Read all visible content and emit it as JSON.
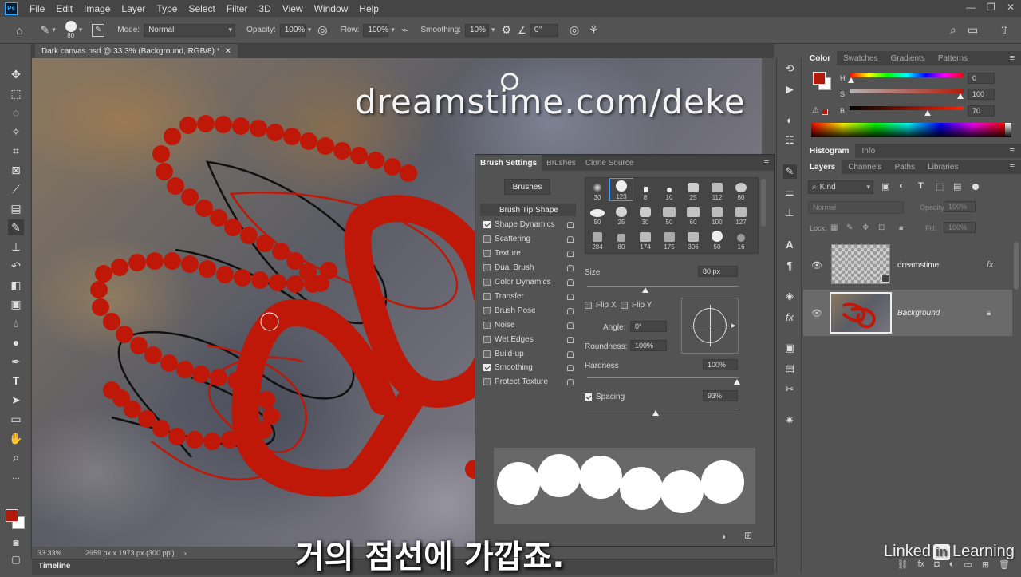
{
  "menu": {
    "app_icon": "Ps",
    "items": [
      "File",
      "Edit",
      "Image",
      "Layer",
      "Type",
      "Select",
      "Filter",
      "3D",
      "View",
      "Window",
      "Help"
    ]
  },
  "options": {
    "brush_size": "80",
    "mode_label": "Mode:",
    "mode_value": "Normal",
    "opacity_label": "Opacity:",
    "opacity_value": "100%",
    "flow_label": "Flow:",
    "flow_value": "100%",
    "smoothing_label": "Smoothing:",
    "smoothing_value": "10%",
    "angle_value": "0°"
  },
  "document": {
    "tab_title": "Dark canvas.psd @ 33.3% (Background, RGB/8) *",
    "zoom": "33.33%",
    "dimensions": "2959 px x 1973 px (300 ppi)",
    "watermark": "dreamstime.com/deke"
  },
  "timeline_label": "Timeline",
  "brush_panel": {
    "tabs": [
      "Brush Settings",
      "Brushes",
      "Clone Source"
    ],
    "brushes_button": "Brushes",
    "brush_tip_shape": "Brush Tip Shape",
    "options": [
      {
        "label": "Shape Dynamics",
        "checked": true
      },
      {
        "label": "Scattering",
        "checked": false
      },
      {
        "label": "Texture",
        "checked": false
      },
      {
        "label": "Dual Brush",
        "checked": false
      },
      {
        "label": "Color Dynamics",
        "checked": false
      },
      {
        "label": "Transfer",
        "checked": false
      },
      {
        "label": "Brush Pose",
        "checked": false
      },
      {
        "label": "Noise",
        "checked": false
      },
      {
        "label": "Wet Edges",
        "checked": false
      },
      {
        "label": "Build-up",
        "checked": false
      },
      {
        "label": "Smoothing",
        "checked": true
      },
      {
        "label": "Protect Texture",
        "checked": false
      }
    ],
    "tips_row1": [
      "30",
      "123",
      "8",
      "10",
      "25",
      "112",
      "60"
    ],
    "tips_row2": [
      "50",
      "25",
      "30",
      "50",
      "60",
      "100",
      "127"
    ],
    "tips_row3": [
      "284",
      "80",
      "174",
      "175",
      "306",
      "50",
      "16"
    ],
    "size_label": "Size",
    "size_value": "80 px",
    "flip_x": "Flip X",
    "flip_y": "Flip Y",
    "angle_label": "Angle:",
    "angle_value": "0°",
    "roundness_label": "Roundness:",
    "roundness_value": "100%",
    "hardness_label": "Hardness",
    "hardness_value": "100%",
    "spacing_label": "Spacing",
    "spacing_value": "93%"
  },
  "color_panel": {
    "tabs": [
      "Color",
      "Swatches",
      "Gradients",
      "Patterns"
    ],
    "h_label": "H",
    "h_value": "0",
    "s_label": "S",
    "s_value": "100",
    "b_label": "B",
    "b_value": "70",
    "foreground_color": "#b31a0a"
  },
  "histogram_tabs": [
    "Histogram",
    "Info"
  ],
  "layers_panel": {
    "tabs": [
      "Layers",
      "Channels",
      "Paths",
      "Libraries"
    ],
    "kind_label": "Kind",
    "blend_mode": "Normal",
    "opacity_label": "Opacity:",
    "opacity_value": "100%",
    "lock_label": "Lock:",
    "fill_label": "Fill:",
    "fill_value": "100%",
    "layers": [
      {
        "name": "dreamstime",
        "selected": false
      },
      {
        "name": "Background",
        "selected": true
      }
    ]
  },
  "subtitle": "거의 점선에 가깝죠.",
  "linkedin": {
    "pre": "Linked",
    "in": "in",
    "post": "Learning"
  }
}
